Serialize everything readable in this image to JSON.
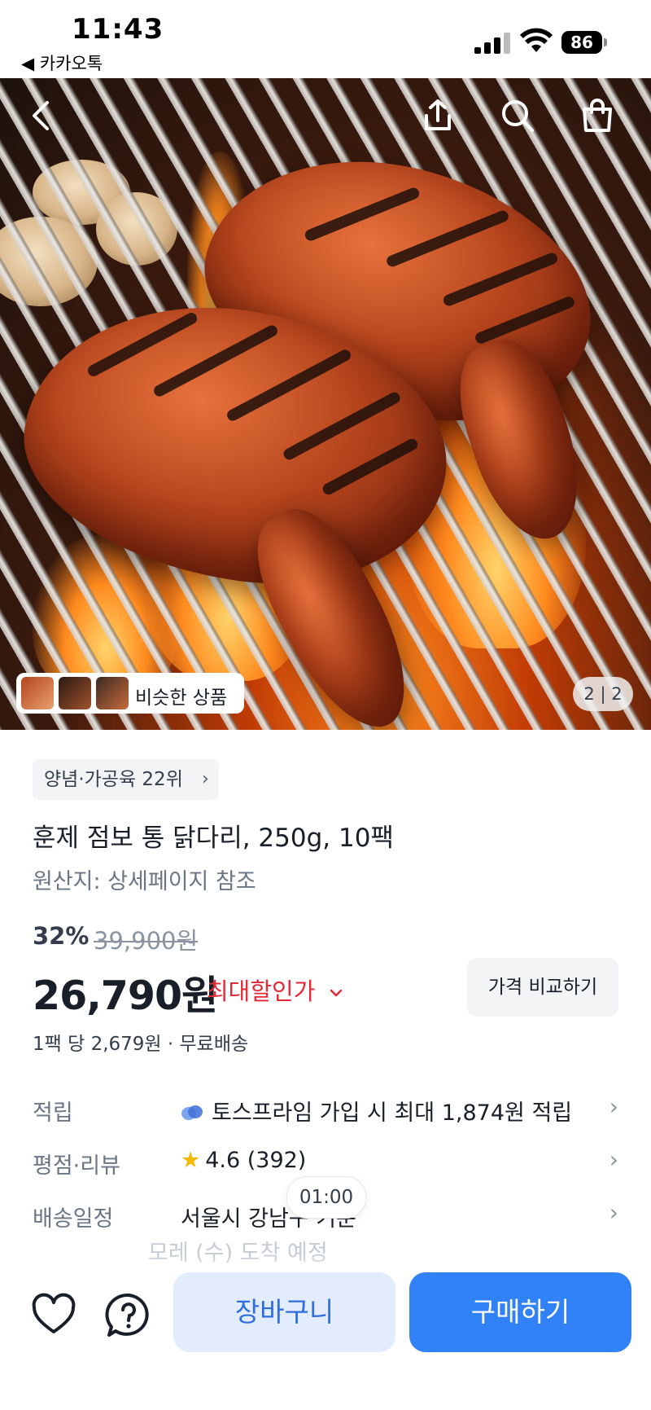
{
  "status_bar": {
    "time": "11:43",
    "back_app": "◀ 카카오톡",
    "battery": "86"
  },
  "hero": {
    "icons": [
      "back-arrow-icon",
      "share-icon",
      "search-icon",
      "shopping-bag-icon"
    ],
    "similar_label": "비슷한 상품",
    "pager": "2 | 2"
  },
  "product": {
    "rank_label": "양념·가공육 22위",
    "title": "훈제 점보 통 닭다리, 250g, 10팩",
    "origin": "원산지: 상세페이지 참조",
    "discount_rate": "32%",
    "original_price": "39,900원",
    "price": "26,790원",
    "max_discount_label": "최대할인가",
    "compare_button": "가격 비교하기",
    "per_pack": "1팩 당 2,679원 · 무료배송"
  },
  "info_rows": [
    {
      "label": "적립",
      "value": "토스프라임 가입 시 최대 1,874원 적립"
    },
    {
      "label": "평점·리뷰",
      "value": "4.6 (392)"
    },
    {
      "label": "배송일정",
      "value": "서울시 강남구 기준"
    }
  ],
  "delivery_faded": "모레 (수) 도착 예정",
  "timer": "01:00",
  "bottom_bar": {
    "cart_label": "장바구니",
    "buy_label": "구매하기"
  },
  "colors": {
    "primary": "#3182f6",
    "primary_light": "#e2ecfd",
    "discount_red": "#e42939"
  }
}
